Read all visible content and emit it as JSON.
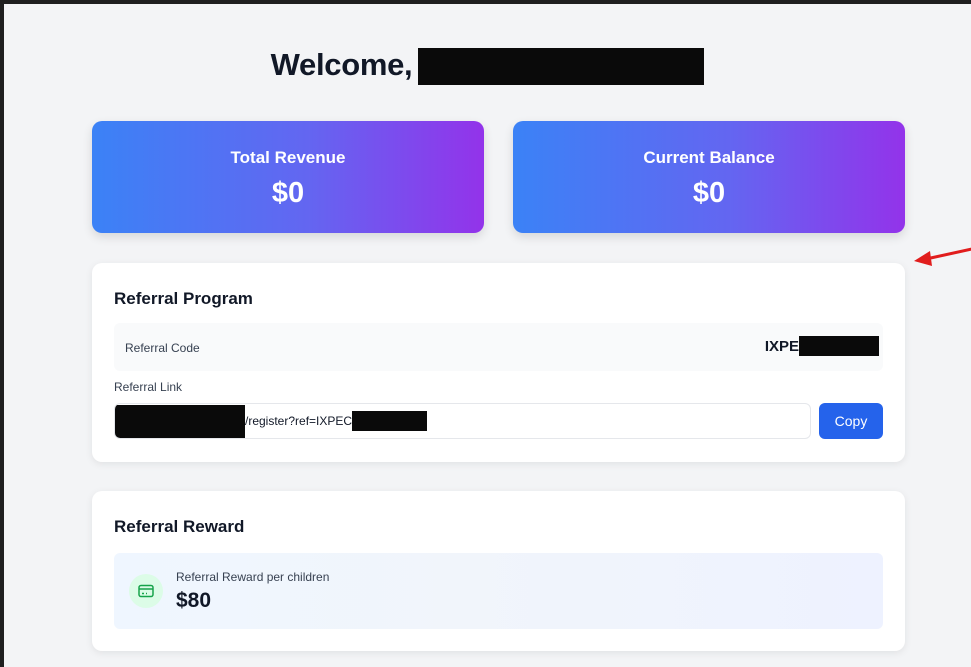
{
  "header": {
    "welcome": "Welcome,"
  },
  "stats": [
    {
      "title": "Total Revenue",
      "value": "$0"
    },
    {
      "title": "Current Balance",
      "value": "$0"
    }
  ],
  "referral": {
    "title": "Referral Program",
    "code_label": "Referral Code",
    "code_prefix": "IXPE",
    "link_label": "Referral Link",
    "link_text": "/register?ref=IXPEC",
    "copy_label": "Copy"
  },
  "reward": {
    "title": "Referral Reward",
    "label": "Referral Reward per children",
    "value": "$80"
  },
  "colors": {
    "gradient_start": "#3b82f6",
    "gradient_end": "#9333ea",
    "copy_button": "#2563eb",
    "arrow": "#e11d1d"
  }
}
